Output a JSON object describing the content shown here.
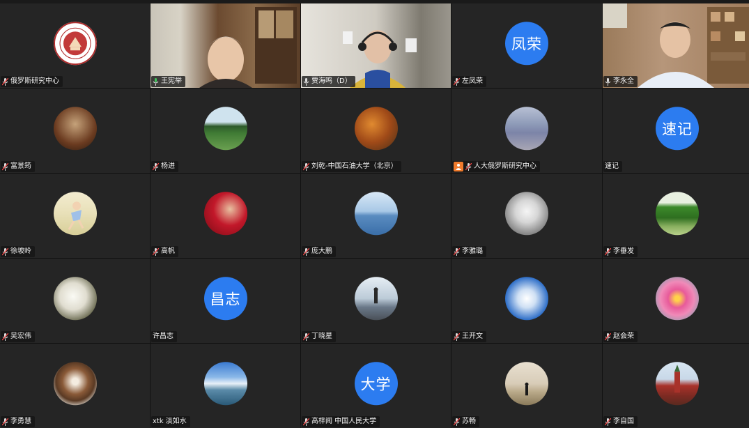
{
  "participants": [
    {
      "name": "俄罗斯研究中心",
      "type": "logo",
      "mic": "muted"
    },
    {
      "name": "王宪举",
      "type": "video",
      "mic": "active",
      "speaking": true
    },
    {
      "name": "贾海鸣（D）",
      "type": "video",
      "mic": "on"
    },
    {
      "name": "左凤荣",
      "type": "initials",
      "initials": "凤荣",
      "mic": "muted"
    },
    {
      "name": "李永全",
      "type": "video",
      "mic": "on"
    },
    {
      "name": "富景筠",
      "type": "avatar",
      "mic": "muted"
    },
    {
      "name": "杨进",
      "type": "avatar",
      "mic": "muted"
    },
    {
      "name": "刘乾-中国石油大学（北京）",
      "type": "avatar",
      "mic": "muted"
    },
    {
      "name": "人大俄罗斯研究中心",
      "type": "avatar",
      "mic": "muted",
      "badge": "person-icon"
    },
    {
      "name": "速记",
      "type": "initials",
      "initials": "速记",
      "mic": "none"
    },
    {
      "name": "徐坡岭",
      "type": "avatar",
      "mic": "muted"
    },
    {
      "name": "高帆",
      "type": "avatar",
      "mic": "muted"
    },
    {
      "name": "庞大鹏",
      "type": "avatar",
      "mic": "muted"
    },
    {
      "name": "李雅璐",
      "type": "avatar",
      "mic": "muted"
    },
    {
      "name": "李垂发",
      "type": "avatar",
      "mic": "muted"
    },
    {
      "name": "吴宏伟",
      "type": "avatar",
      "mic": "muted"
    },
    {
      "name": "许昌志",
      "type": "initials",
      "initials": "昌志",
      "mic": "none"
    },
    {
      "name": "丁晓星",
      "type": "avatar",
      "mic": "muted"
    },
    {
      "name": "王开文",
      "type": "avatar",
      "mic": "muted"
    },
    {
      "name": "赵会荣",
      "type": "avatar",
      "mic": "muted"
    },
    {
      "name": "李勇慧",
      "type": "avatar",
      "mic": "muted"
    },
    {
      "name": "xtk 淡如水",
      "type": "avatar",
      "mic": "none"
    },
    {
      "name": "高梓闻 中国人民大学",
      "type": "initials",
      "initials": "大学",
      "mic": "muted"
    },
    {
      "name": "苏畅",
      "type": "avatar",
      "mic": "muted"
    },
    {
      "name": "李自国",
      "type": "avatar",
      "mic": "muted"
    }
  ],
  "colors": {
    "initials_bg": "#2c7cf0",
    "speaking_border": "#3fc35a",
    "tile_bg": "#252525"
  },
  "logo": {
    "text": "RENMIN UNIVERSITY OF CHINA",
    "year": "1937"
  }
}
